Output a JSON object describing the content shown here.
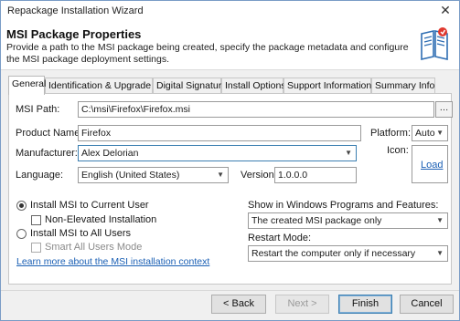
{
  "window": {
    "title": "Repackage Installation Wizard",
    "close_glyph": "✕"
  },
  "header": {
    "title": "MSI Package Properties",
    "description": "Provide a path to the MSI package being created, specify the package metadata and configure the MSI package deployment settings.",
    "icon": "book-icon"
  },
  "tabs": [
    {
      "label": "General",
      "active": true
    },
    {
      "label": "Identification & Upgrade"
    },
    {
      "label": "Digital Signature"
    },
    {
      "label": "Install Options"
    },
    {
      "label": "Support Information"
    },
    {
      "label": "Summary Info"
    }
  ],
  "general": {
    "msi_path_label": "MSI Path:",
    "msi_path_value": "C:\\msi\\Firefox\\Firefox.msi",
    "browse_label": "…",
    "product_name_label": "Product Name:",
    "product_name_value": "Firefox",
    "platform_label": "Platform:",
    "platform_value": "Auto",
    "manufacturer_label": "Manufacturer:",
    "manufacturer_value": "Alex Delorian",
    "icon_label": "Icon:",
    "load_link": "Load",
    "language_label": "Language:",
    "language_value": "English (United States)",
    "version_label": "Version:",
    "version_value": "1.0.0.0"
  },
  "install": {
    "current_user_label": "Install MSI to Current User",
    "current_user_selected": true,
    "non_elevated_label": "Non-Elevated Installation",
    "non_elevated_checked": false,
    "all_users_label": "Install MSI to All Users",
    "all_users_selected": false,
    "smart_all_users_label": "Smart All Users Mode",
    "smart_all_users_checked": false,
    "learn_more_link": "Learn more about the MSI installation context"
  },
  "programs": {
    "show_label": "Show in Windows Programs and Features:",
    "show_value": "The created MSI package only",
    "restart_label": "Restart Mode:",
    "restart_value": "Restart the computer only if necessary"
  },
  "footer": {
    "back_label": "< Back",
    "next_label": "Next >",
    "finish_label": "Finish",
    "cancel_label": "Cancel"
  }
}
